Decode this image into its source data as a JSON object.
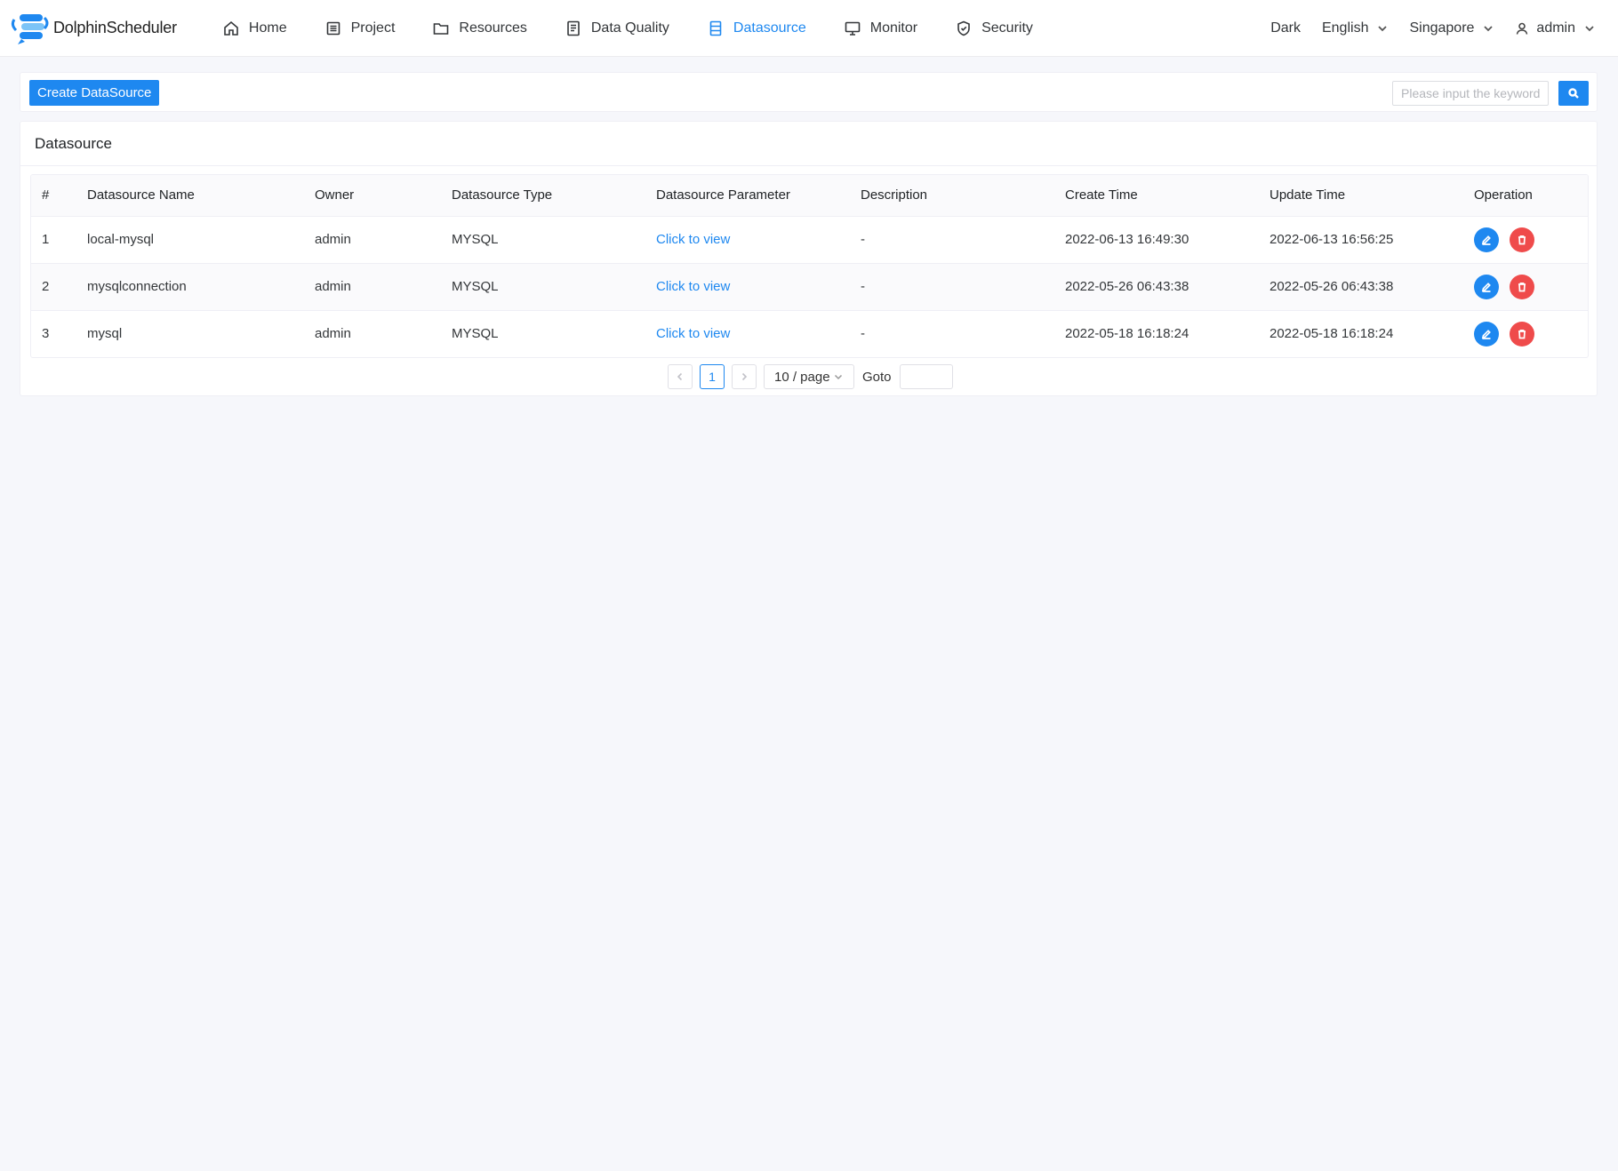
{
  "app": {
    "name": "DolphinScheduler"
  },
  "nav": {
    "items": [
      {
        "label": "Home",
        "icon": "home-icon"
      },
      {
        "label": "Project",
        "icon": "project-icon"
      },
      {
        "label": "Resources",
        "icon": "folder-icon"
      },
      {
        "label": "Data Quality",
        "icon": "document-icon"
      },
      {
        "label": "Datasource",
        "icon": "database-icon",
        "active": true
      },
      {
        "label": "Monitor",
        "icon": "monitor-icon"
      },
      {
        "label": "Security",
        "icon": "shield-icon"
      }
    ],
    "active_color": "#1e88f0"
  },
  "header_right": {
    "theme": "Dark",
    "language": "English",
    "timezone": "Singapore",
    "user": "admin"
  },
  "toolbar": {
    "create_label": "Create DataSource",
    "search_placeholder": "Please input the keywords"
  },
  "card": {
    "title": "Datasource"
  },
  "table": {
    "columns": [
      "#",
      "Datasource Name",
      "Owner",
      "Datasource Type",
      "Datasource Parameter",
      "Description",
      "Create Time",
      "Update Time",
      "Operation"
    ],
    "rows": [
      {
        "index": "1",
        "name": "local-mysql",
        "owner": "admin",
        "type": "MYSQL",
        "param": "Click to view",
        "description": "-",
        "create_time": "2022-06-13 16:49:30",
        "update_time": "2022-06-13 16:56:25"
      },
      {
        "index": "2",
        "name": "mysqlconnection",
        "owner": "admin",
        "type": "MYSQL",
        "param": "Click to view",
        "description": "-",
        "create_time": "2022-05-26 06:43:38",
        "update_time": "2022-05-26 06:43:38"
      },
      {
        "index": "3",
        "name": "mysql",
        "owner": "admin",
        "type": "MYSQL",
        "param": "Click to view",
        "description": "-",
        "create_time": "2022-05-18 16:18:24",
        "update_time": "2022-05-18 16:18:24"
      }
    ]
  },
  "pagination": {
    "current_page": "1",
    "page_size": "10 / page",
    "goto_label": "Goto"
  },
  "colors": {
    "primary": "#1e88f0",
    "danger": "#ef4b4b",
    "background": "#f6f7fb"
  }
}
